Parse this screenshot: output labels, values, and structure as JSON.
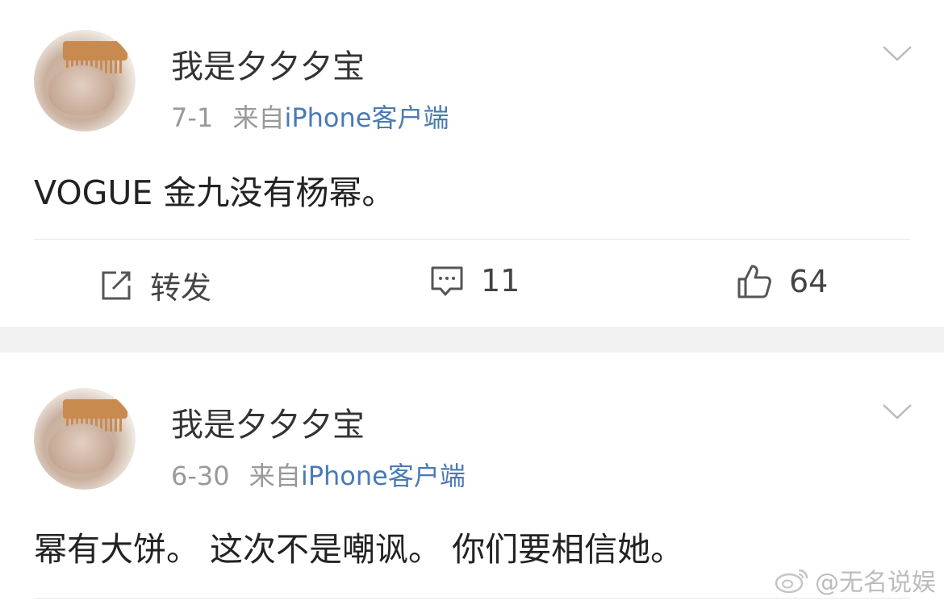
{
  "posts": [
    {
      "username": "我是夕夕夕宝",
      "date": "7-1",
      "source_prefix": "来自",
      "source": "iPhone客户端",
      "content": "VOGUE 金九没有杨幂。",
      "actions": {
        "repost_label": "转发",
        "comment_count": "11",
        "like_count": "64"
      }
    },
    {
      "username": "我是夕夕夕宝",
      "date": "6-30",
      "source_prefix": "来自",
      "source": "iPhone客户端",
      "content": "幂有大饼。 这次不是嘲讽。 你们要相信她。"
    }
  ],
  "watermark": "@无名说娱",
  "icons": [
    "chevron-down-icon",
    "repost-icon",
    "comment-icon",
    "like-icon",
    "weibo-icon"
  ],
  "colors": {
    "source_link": "#4a7ab5",
    "separator": "#f2f2f2",
    "meta": "#999999"
  }
}
